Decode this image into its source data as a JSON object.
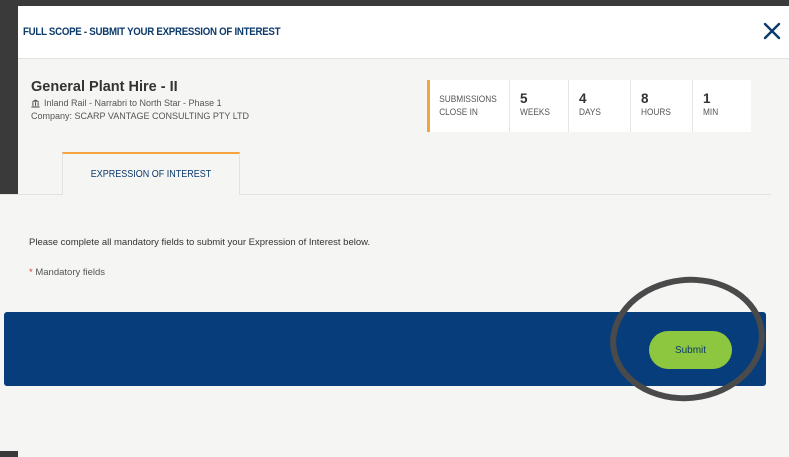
{
  "modal": {
    "title": "FULL SCOPE - SUBMIT YOUR EXPRESSION OF INTEREST",
    "close_icon": "close-icon"
  },
  "project": {
    "name": "General Plant Hire - II",
    "location": "Inland Rail - Narrabri to North Star - Phase 1",
    "location_icon": "bank-icon",
    "company": "Company: SCARP VANTAGE CONSULTING PTY LTD"
  },
  "countdown": {
    "label_line1": "SUBMISSIONS",
    "label_line2": "CLOSE IN",
    "cells": [
      {
        "value": "5",
        "unit": "WEEKS"
      },
      {
        "value": "4",
        "unit": "DAYS"
      },
      {
        "value": "8",
        "unit": "HOURS"
      },
      {
        "value": "1",
        "unit": "MIN"
      }
    ],
    "accent_color": "#f4a340"
  },
  "tabs": [
    {
      "label": "EXPRESSION OF INTEREST",
      "active": true
    }
  ],
  "form": {
    "instructions": "Please complete all mandatory fields to submit your Expression of Interest below.",
    "mandatory_marker": "*",
    "mandatory_text": "Mandatory fields"
  },
  "footer": {
    "submit_label": "Submit",
    "bar_color": "#063d7a",
    "button_color": "#8dc63f"
  }
}
